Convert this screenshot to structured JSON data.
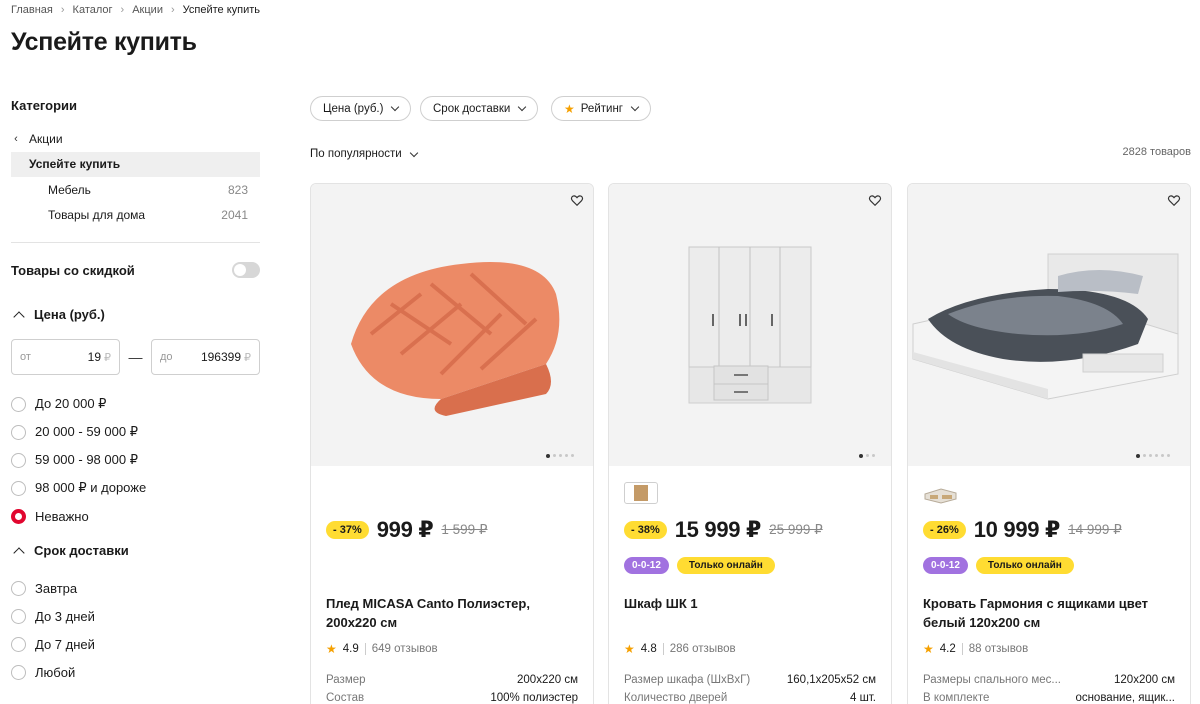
{
  "breadcrumb": {
    "items": [
      "Главная",
      "Каталог",
      "Акции"
    ],
    "current": "Успейте купить"
  },
  "page_title": "Успейте купить",
  "sidebar": {
    "categories_heading": "Категории",
    "back_label": "Акции",
    "current": "Успейте купить",
    "subcats": [
      {
        "label": "Мебель",
        "count": "823"
      },
      {
        "label": "Товары для дома",
        "count": "2041"
      }
    ],
    "discount_toggle": {
      "label": "Товары со скидкой",
      "on": false
    },
    "price": {
      "heading": "Цена (руб.)",
      "from_prefix": "от",
      "from_value": "19",
      "to_prefix": "до",
      "to_value": "196399",
      "currency": "₽",
      "dash": "—",
      "options": [
        "До 20 000 ₽",
        "20 000 - 59 000 ₽",
        "59 000 - 98 000 ₽",
        "98 000 ₽ и дороже",
        "Неважно"
      ],
      "selected": "Неважно"
    },
    "delivery": {
      "heading": "Срок доставки",
      "options": [
        "Завтра",
        "До 3 дней",
        "До 7 дней",
        "Любой"
      ]
    }
  },
  "filters": {
    "price": "Цена (руб.)",
    "delivery": "Срок доставки",
    "rating": "Рейтинг",
    "sort": "По популярности",
    "count": "2828 товаров"
  },
  "colors": {
    "accent": "#e1062f",
    "discount_badge": "#ffdc32",
    "tag_purple": "#a172e0",
    "star": "#f5a000"
  },
  "products": [
    {
      "discount": "- 37%",
      "price": "999 ₽",
      "old_price": "1 599 ₽",
      "name": "Плед MICASA Canto Полиэстер, 200х220 см",
      "rating": "4.9",
      "reviews": "649 отзывов",
      "specs": [
        {
          "k": "Размер",
          "v": "200х220 см"
        },
        {
          "k": "Состав",
          "v": "100% полиэстер"
        }
      ],
      "tags": []
    },
    {
      "discount": "- 38%",
      "price": "15 999 ₽",
      "old_price": "25 999 ₽",
      "name": "Шкаф ШК 1",
      "rating": "4.8",
      "reviews": "286 отзывов",
      "specs": [
        {
          "k": "Размер шкафа (ШхВхГ)",
          "v": "160,1х205х52 см"
        },
        {
          "k": "Количество дверей",
          "v": "4 шт."
        }
      ],
      "tags": [
        "0-0-12",
        "Только онлайн"
      ]
    },
    {
      "discount": "- 26%",
      "price": "10 999 ₽",
      "old_price": "14 999 ₽",
      "name": "Кровать Гармония с ящиками цвет белый 120х200 см",
      "rating": "4.2",
      "reviews": "88 отзывов",
      "specs": [
        {
          "k": "Размеры спального мес...",
          "v": "120х200 см"
        },
        {
          "k": "В комплекте",
          "v": "основание, ящик..."
        }
      ],
      "tags": [
        "0-0-12",
        "Только онлайн"
      ]
    }
  ]
}
